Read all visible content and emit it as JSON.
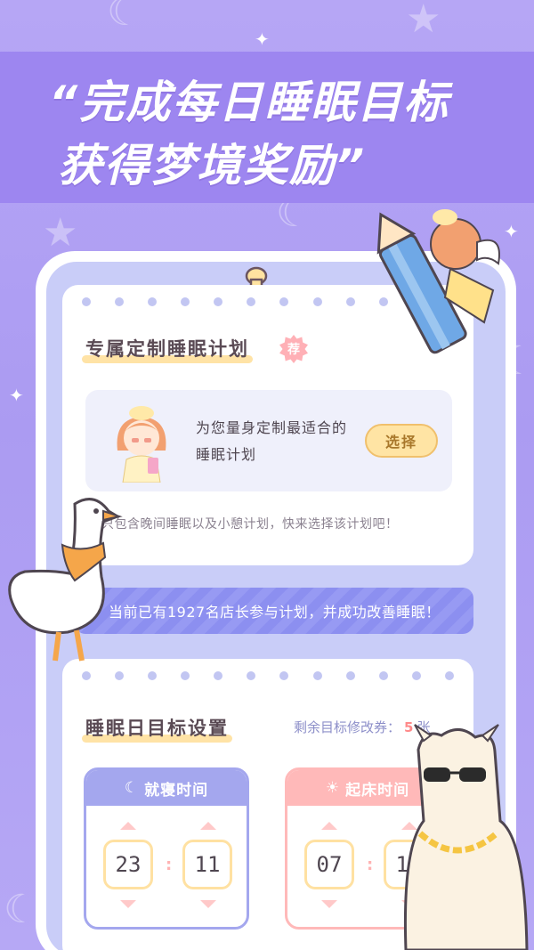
{
  "headline": {
    "line1": "“完成每日睡眠目标",
    "line2": "获得梦境奖励”"
  },
  "plan_card": {
    "title": "专属定制睡眠计划",
    "badge": "荐",
    "description": "为您量身定制最适合的睡眠计划",
    "button": "选择",
    "note": "只包含晚间睡眠以及小憩计划，快来选择该计划吧！"
  },
  "stat_banner": "当前已有1927名店长参与计划，并成功改善睡眠！",
  "goal_card": {
    "title": "睡眠日目标设置",
    "coupon_label": "剩余目标修改券：",
    "coupon_count": "5",
    "coupon_unit": "张",
    "bedtime": {
      "label": "就寝时间",
      "icon": "moon-icon",
      "hour": "23",
      "minute": "11"
    },
    "waketime": {
      "label": "起床时间",
      "icon": "sun-icon",
      "hour": "07",
      "minute": "11"
    }
  },
  "colors": {
    "background": "#ab9bf2",
    "banner": "#9d86f0",
    "accent_yellow": "#ffe4a4",
    "bed_panel": "#a4a7ee",
    "wake_panel": "#ffb9b9",
    "stat_bar": "#8c8ff0"
  }
}
